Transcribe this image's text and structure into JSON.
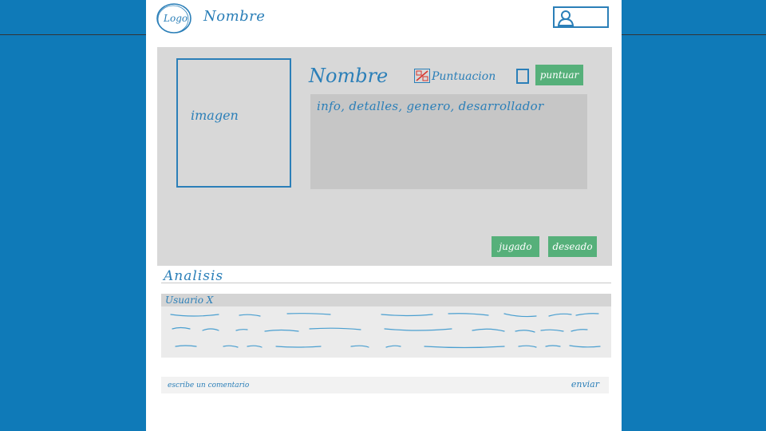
{
  "header": {
    "logo_text": "Logo",
    "site_name": "Nombre",
    "user_icon": "user-icon"
  },
  "game": {
    "image_label": "imagen",
    "title": "Nombre",
    "score_label": "Puntuacion",
    "score_icon": "score-badge-icon",
    "rate_button": "puntuar",
    "info_text": "info, detalles, genero, desarrollador",
    "played_button": "jugado",
    "wished_button": "deseado"
  },
  "analysis": {
    "title": "Analisis"
  },
  "comments": [
    {
      "user": "Usuario X"
    }
  ],
  "comment_form": {
    "placeholder": "escribe un comentario",
    "send_label": "enviar"
  },
  "colors": {
    "background": "#0f7ab8",
    "sketch_blue": "#2b7fb8",
    "button_green": "#56b07a",
    "panel_grey": "#d8d8d8"
  }
}
